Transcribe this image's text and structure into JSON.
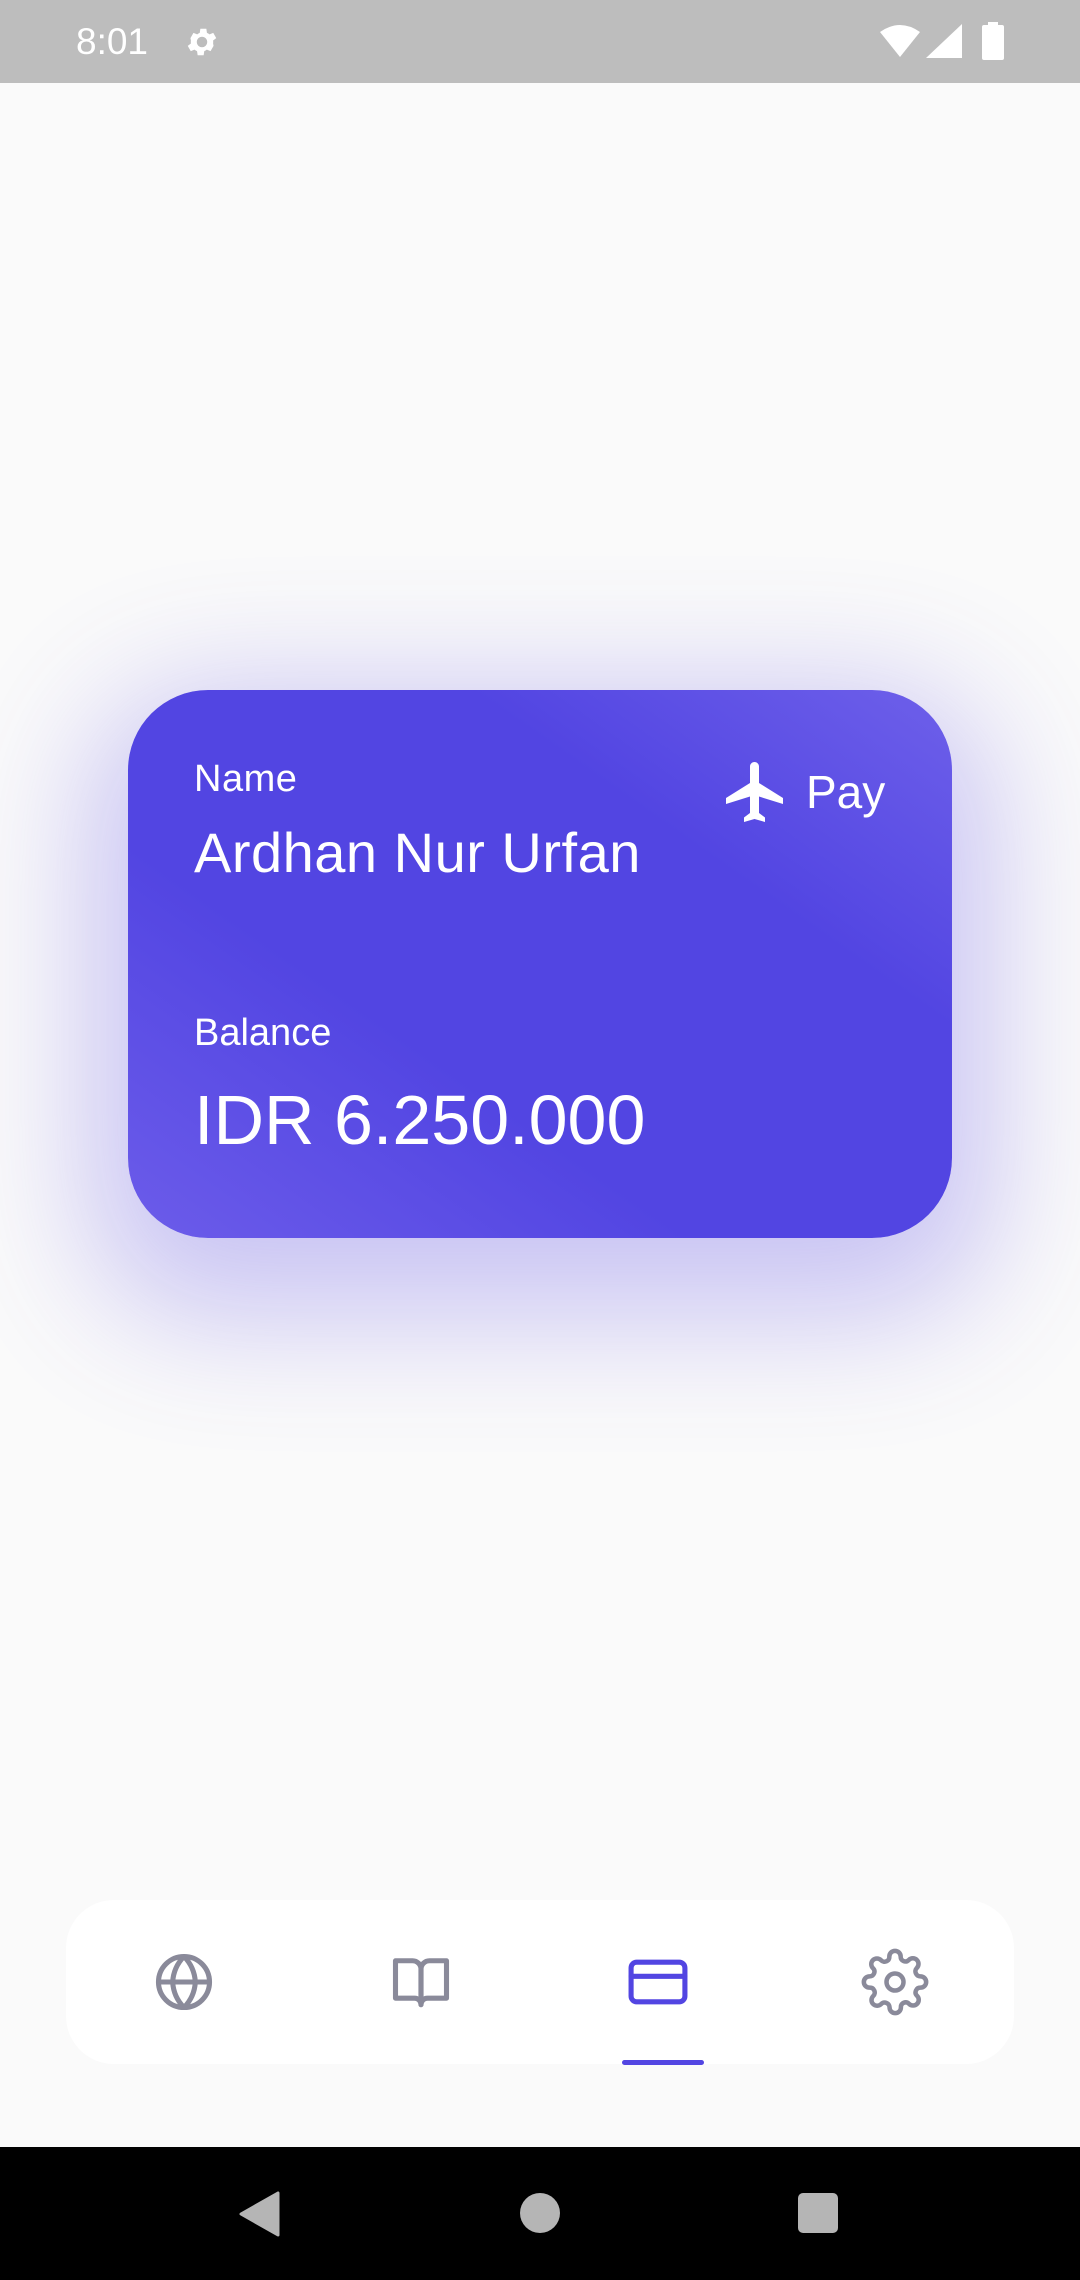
{
  "status_bar": {
    "time": "8:01",
    "icons": [
      "gear-icon",
      "wifi-icon",
      "signal-icon",
      "battery-icon"
    ]
  },
  "card": {
    "name_label": "Name",
    "holder_name": "Ardhan Nur Urfan",
    "brand_icon": "airplane-icon",
    "brand_label": "Pay",
    "balance_label": "Balance",
    "balance_value": "IDR 6.250.000",
    "colors": {
      "gradient_start": "#6C5CEA",
      "gradient_main": "#5245E2",
      "text": "#FFFFFF"
    }
  },
  "bottom_nav": {
    "items": [
      {
        "icon": "globe-icon",
        "active": false
      },
      {
        "icon": "book-icon",
        "active": false
      },
      {
        "icon": "credit-card-icon",
        "active": true
      },
      {
        "icon": "gear-icon",
        "active": false
      }
    ],
    "colors": {
      "active": "#5245E2",
      "inactive": "#8A8A9A"
    }
  },
  "system_nav": {
    "buttons": [
      "back-icon",
      "home-icon",
      "recents-icon"
    ]
  }
}
